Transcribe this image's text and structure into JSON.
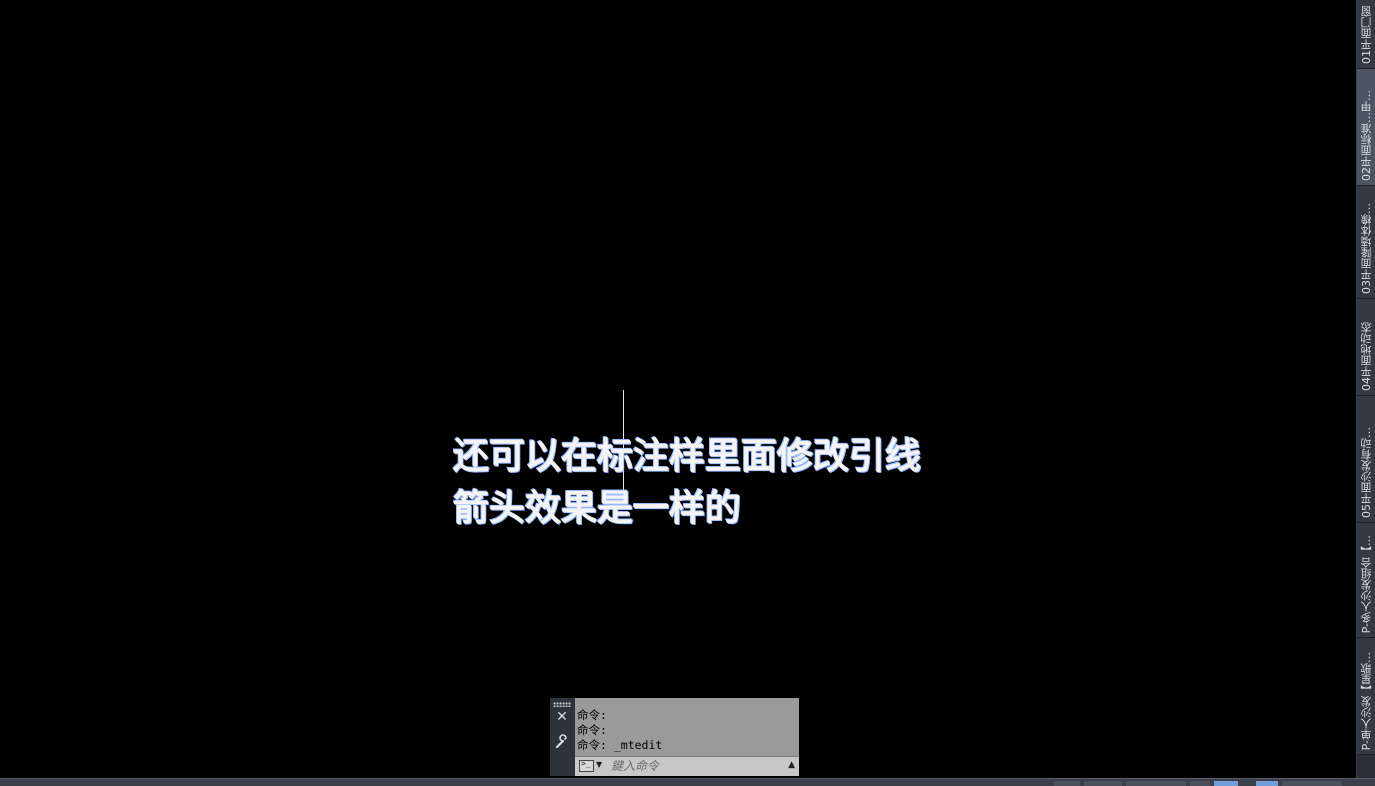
{
  "canvas": {
    "mtext_lines": [
      "还可以在标注样里面修改引线",
      "箭头效果是一样的"
    ]
  },
  "layout_tabs": [
    {
      "label": "01平面门窗",
      "active": false
    },
    {
      "label": "02平面标准…甲…",
      "active": true
    },
    {
      "label": "03平面隆墙体橡…",
      "active": false
    },
    {
      "label": "04平面地动态",
      "active": false
    },
    {
      "label": "05平面沙发有动…",
      "active": false
    },
    {
      "label": "P-多人沙发组合【…",
      "active": false
    },
    {
      "label": "P-单人沙发【星歌…",
      "active": false
    }
  ],
  "command_line": {
    "history": [
      "命令:",
      "命令:",
      "命令: _mtedit"
    ],
    "placeholder": "鍵入命令",
    "icons": {
      "grip": "grip-icon",
      "close": "close-icon",
      "customize": "wrench-icon",
      "prompt": "command-prompt-icon",
      "expand": "chevron-up-icon"
    }
  },
  "colors": {
    "canvas_bg": "#000000",
    "text": "#f4f4f4",
    "history_bg": "#9a9a9a"
  }
}
